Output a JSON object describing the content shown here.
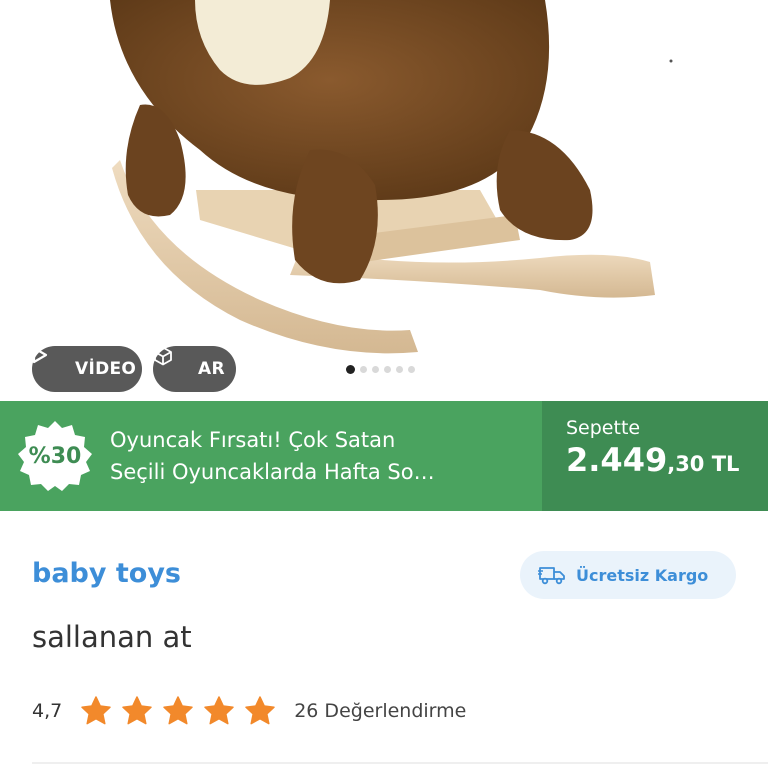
{
  "media": {
    "video_label": "VİDEO",
    "ar_label": "AR",
    "carousel_total": 6,
    "carousel_active": 1
  },
  "promo": {
    "badge": "%30",
    "line1": "Oyuncak Fırsatı! Çok Satan",
    "line2": "Seçili Oyuncaklarda Hafta So…",
    "basket_label": "Sepette",
    "price_main": "2.449",
    "price_cents": ",30",
    "currency": " TL"
  },
  "product": {
    "brand": "baby toys",
    "title": "sallanan at",
    "rating": "4,7",
    "stars_filled": 5,
    "review_count": "26 Değerlendirme"
  },
  "cargo": {
    "label": "Ücretsiz Kargo"
  },
  "colors": {
    "promo_green": "#4aa35f",
    "promo_dark_green": "#3e8c53",
    "brand_blue": "#3d8ed8",
    "star_orange": "#f2892b"
  }
}
